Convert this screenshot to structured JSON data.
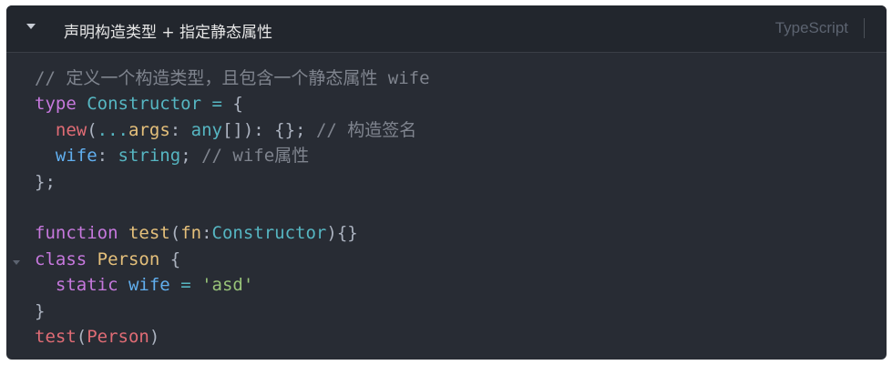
{
  "header": {
    "title": "声明构造类型 + 指定静态属性",
    "language": "TypeScript"
  },
  "code_lines": [
    [
      {
        "t": "// 定义一个构造类型，且包含一个静态属性 wife",
        "c": "comment"
      }
    ],
    [
      {
        "t": "type",
        "c": "kw"
      },
      {
        "t": " ",
        "c": "punc"
      },
      {
        "t": "Constructor",
        "c": "type"
      },
      {
        "t": " ",
        "c": "punc"
      },
      {
        "t": "=",
        "c": "op"
      },
      {
        "t": " {",
        "c": "punc"
      }
    ],
    [
      {
        "t": "  ",
        "c": "punc"
      },
      {
        "t": "new",
        "c": "new"
      },
      {
        "t": "(",
        "c": "punc"
      },
      {
        "t": "...",
        "c": "op"
      },
      {
        "t": "args",
        "c": "param"
      },
      {
        "t": ": ",
        "c": "punc"
      },
      {
        "t": "any",
        "c": "type"
      },
      {
        "t": "[]): {}; ",
        "c": "punc"
      },
      {
        "t": "// 构造签名",
        "c": "comment"
      }
    ],
    [
      {
        "t": "  ",
        "c": "punc"
      },
      {
        "t": "wife",
        "c": "prop"
      },
      {
        "t": ": ",
        "c": "punc"
      },
      {
        "t": "string",
        "c": "type"
      },
      {
        "t": "; ",
        "c": "punc"
      },
      {
        "t": "// wife属性",
        "c": "comment"
      }
    ],
    [
      {
        "t": "};",
        "c": "punc"
      }
    ],
    [
      {
        "t": "",
        "c": "punc"
      }
    ],
    [
      {
        "t": "function",
        "c": "kw"
      },
      {
        "t": " ",
        "c": "punc"
      },
      {
        "t": "test",
        "c": "fn"
      },
      {
        "t": "(",
        "c": "punc"
      },
      {
        "t": "fn",
        "c": "param"
      },
      {
        "t": ":",
        "c": "punc"
      },
      {
        "t": "Constructor",
        "c": "type"
      },
      {
        "t": "){}",
        "c": "punc"
      }
    ],
    [
      {
        "t": "class",
        "c": "kw"
      },
      {
        "t": " ",
        "c": "punc"
      },
      {
        "t": "Person",
        "c": "class"
      },
      {
        "t": " {",
        "c": "punc"
      }
    ],
    [
      {
        "t": "  ",
        "c": "punc"
      },
      {
        "t": "static",
        "c": "kw"
      },
      {
        "t": " ",
        "c": "punc"
      },
      {
        "t": "wife",
        "c": "prop"
      },
      {
        "t": " ",
        "c": "punc"
      },
      {
        "t": "=",
        "c": "op"
      },
      {
        "t": " ",
        "c": "punc"
      },
      {
        "t": "'asd'",
        "c": "str"
      }
    ],
    [
      {
        "t": "}",
        "c": "punc"
      }
    ],
    [
      {
        "t": "test",
        "c": "call"
      },
      {
        "t": "(",
        "c": "punc"
      },
      {
        "t": "Person",
        "c": "call"
      },
      {
        "t": ")",
        "c": "punc"
      }
    ]
  ]
}
